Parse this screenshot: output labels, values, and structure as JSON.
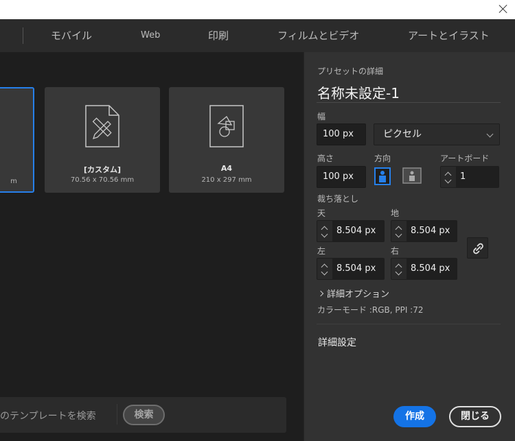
{
  "nav": {
    "tabs": [
      "モバイル",
      "Web",
      "印刷",
      "フィルムとビデオ",
      "アートとイラスト"
    ]
  },
  "presets": [
    {
      "title": "",
      "size": "m",
      "selected": true
    },
    {
      "title": "[カスタム]",
      "size": "70.56 x 70.56 mm",
      "icon": "custom-document-icon"
    },
    {
      "title": "A4",
      "size": "210 x 297 mm",
      "icon": "a4-document-icon"
    }
  ],
  "search": {
    "placeholder": "他のテンプレートを検索",
    "button": "検索"
  },
  "panel": {
    "header": "プリセットの詳細",
    "name": "名称未設定-1",
    "width_label": "幅",
    "width_value": "100 px",
    "unit": "ピクセル",
    "height_label": "高さ",
    "height_value": "100 px",
    "orientation_label": "方向",
    "artboard_label": "アートボード",
    "artboard_value": "1",
    "bleed_label": "裁ち落とし",
    "bleed": {
      "top_label": "天",
      "top_value": "8.504 px",
      "bottom_label": "地",
      "bottom_value": "8.504 px",
      "left_label": "左",
      "left_value": "8.504 px",
      "right_label": "右",
      "right_value": "8.504 px"
    },
    "advanced_options": "詳細オプション",
    "color_mode": "カラーモード :RGB, PPI :72",
    "advanced_settings": "詳細設定",
    "create_button": "作成",
    "close_button": "閉じる"
  },
  "colors": {
    "accent": "#1473e6",
    "selected_border": "#2680eb"
  }
}
